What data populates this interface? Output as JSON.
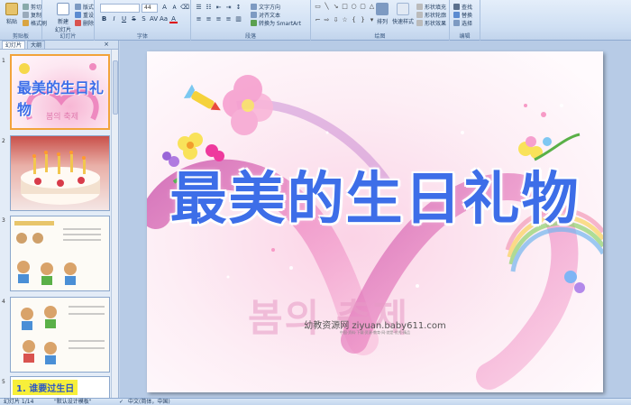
{
  "ribbon": {
    "clipboard": {
      "label": "剪贴板",
      "paste": "粘贴",
      "cut": "剪切",
      "copy": "复制",
      "format_painter": "格式刷"
    },
    "slides": {
      "label": "幻灯片",
      "new_slide": "新建\n幻灯片",
      "layout": "版式",
      "reset": "重设",
      "delete": "删除"
    },
    "font": {
      "label": "字体",
      "font_name": "",
      "font_size": "44"
    },
    "paragraph": {
      "label": "段落",
      "text_direction": "文字方向",
      "align_text": "对齐文本",
      "smartart": "转换为 SmartArt"
    },
    "drawing": {
      "label": "绘图",
      "arrange": "排列",
      "quick_styles": "快速样式",
      "shape_fill": "形状填充",
      "shape_outline": "形状轮廓",
      "shape_effects": "形状效果"
    },
    "editing": {
      "label": "编辑",
      "find": "查找",
      "replace": "替换",
      "select": "选择"
    }
  },
  "left_panel": {
    "tabs": [
      "幻灯片",
      "大纲"
    ],
    "close": "×",
    "thumbnails": [
      {
        "num": "1",
        "title": "最美的生日礼物",
        "subtitle": "봄의 축제"
      },
      {
        "num": "2",
        "caption": ""
      },
      {
        "num": "3",
        "caption": ""
      },
      {
        "num": "4",
        "caption": ""
      },
      {
        "num": "5",
        "title": "1. 谁要过生日"
      }
    ]
  },
  "slide": {
    "title": "最美的生日礼物",
    "korean_text": "봄의 축제",
    "watermark": "幼教资源网 ziyuan.baby611.com",
    "watermark_sub": "中国·资料·下载·资源·教育·网·就是·优秀·精品"
  },
  "status_bar": {
    "slide_info": "幻灯片 1/14",
    "theme": "\"默认设计模板\"",
    "language": "中文(简体，中国)"
  },
  "colors": {
    "accent": "#3d6ee8",
    "ribbon_bg": "#dbe7f6",
    "thumb_selected": "#f2a33a"
  }
}
